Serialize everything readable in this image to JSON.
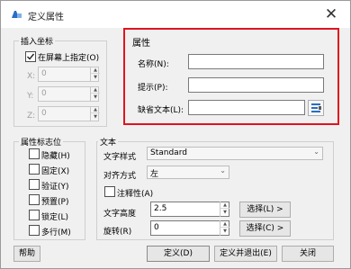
{
  "window": {
    "title": "定义属性",
    "close_glyph": "✕"
  },
  "insert_point": {
    "title": "插入坐标",
    "on_screen": {
      "label": "在屏幕上指定(O)",
      "checked": true
    },
    "x": {
      "label": "X:",
      "value": "0"
    },
    "y": {
      "label": "Y:",
      "value": "0"
    },
    "z": {
      "label": "Z:",
      "value": "0"
    }
  },
  "attribute": {
    "title": "属性",
    "name": {
      "label": "名称(N):",
      "value": ""
    },
    "prompt": {
      "label": "提示(P):",
      "value": ""
    },
    "default": {
      "label": "缺省文本(L):",
      "value": ""
    },
    "insert_field_icon": "insert-field-icon"
  },
  "flags": {
    "title": "属性标志位",
    "items": [
      {
        "label": "隐藏(H)",
        "checked": false
      },
      {
        "label": "固定(X)",
        "checked": false
      },
      {
        "label": "验证(Y)",
        "checked": false
      },
      {
        "label": "预置(P)",
        "checked": false
      },
      {
        "label": "锁定(L)",
        "checked": false
      },
      {
        "label": "多行(M)",
        "checked": false
      }
    ]
  },
  "text": {
    "title": "文本",
    "style": {
      "label": "文字样式",
      "value": "Standard"
    },
    "justify": {
      "label": "对齐方式",
      "value": "左"
    },
    "annotative": {
      "label": "注释性(A)",
      "checked": false
    },
    "height": {
      "label": "文字高度",
      "value": "2.5",
      "pick_label": "选择(L) >"
    },
    "rotation": {
      "label": "旋转(R)",
      "value": "0",
      "pick_label": "选择(C) >"
    }
  },
  "buttons": {
    "help": "帮助",
    "define": "定义(D)",
    "define_exit": "定义并退出(E)",
    "close": "关闭"
  },
  "colors": {
    "highlight_border": "#e0141e",
    "accent_icon": "#2b6cc4"
  }
}
